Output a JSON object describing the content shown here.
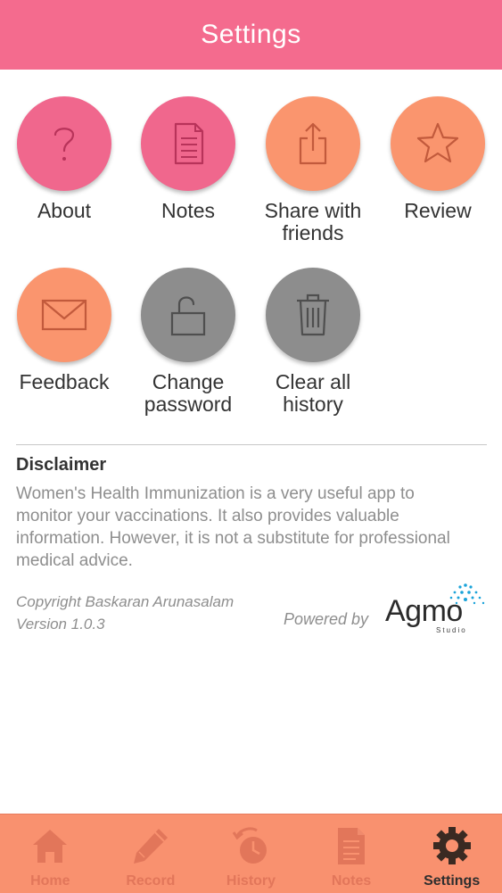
{
  "header": {
    "title": "Settings"
  },
  "colors": {
    "header": "#f46b8e",
    "pink": "#f0678d",
    "orange": "#fa956e",
    "gray": "#8d8d8d",
    "tabbar": "#f9916f"
  },
  "tiles": [
    {
      "label": "About",
      "icon": "question-icon",
      "color": "pink"
    },
    {
      "label": "Notes",
      "icon": "document-icon",
      "color": "pink"
    },
    {
      "label": "Share with friends",
      "icon": "share-icon",
      "color": "orange"
    },
    {
      "label": "Review",
      "icon": "star-icon",
      "color": "orange"
    },
    {
      "label": "Feedback",
      "icon": "envelope-icon",
      "color": "orange"
    },
    {
      "label": "Change password",
      "icon": "unlock-icon",
      "color": "gray"
    },
    {
      "label": "Clear all history",
      "icon": "trash-icon",
      "color": "gray"
    }
  ],
  "disclaimer": {
    "title": "Disclaimer",
    "body": "Women's Health Immunization is a very useful app to monitor your vaccinations. It also provides valuable information. However, it is not a substitute for professional medical advice."
  },
  "footer": {
    "copyright": "Copyright Baskaran Arunasalam",
    "version": "Version 1.0.3",
    "powered_by": "Powered by",
    "brand": "Agmo",
    "brand_sub": "Studio"
  },
  "tabs": [
    {
      "label": "Home",
      "icon": "home-icon",
      "active": false
    },
    {
      "label": "Record",
      "icon": "pencil-icon",
      "active": false
    },
    {
      "label": "History",
      "icon": "history-clock-icon",
      "active": false
    },
    {
      "label": "Notes",
      "icon": "notes-icon",
      "active": false
    },
    {
      "label": "Settings",
      "icon": "gear-icon",
      "active": true
    }
  ]
}
